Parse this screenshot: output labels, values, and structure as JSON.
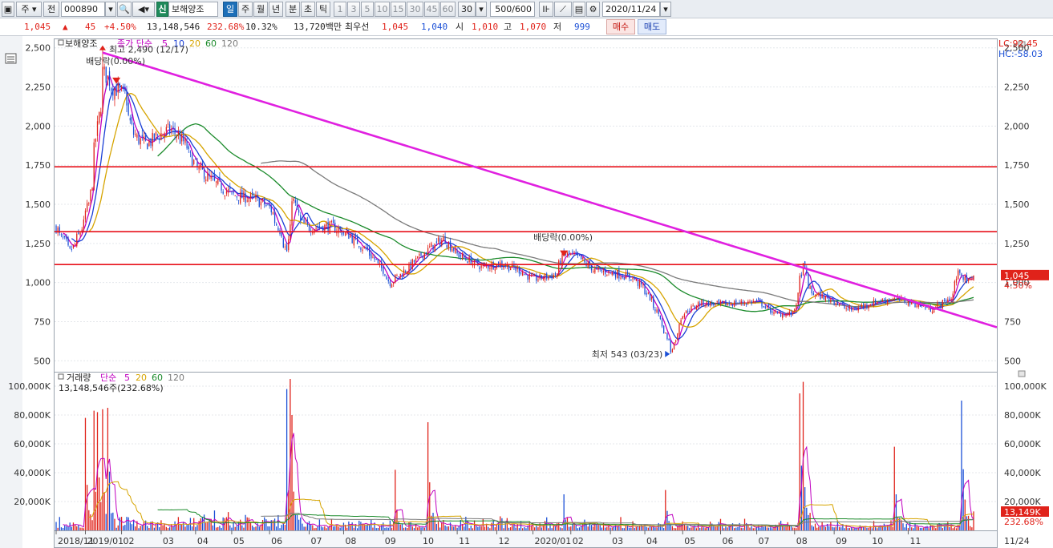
{
  "toolbar": {
    "type_label": "주",
    "type2_label": "전",
    "code_value": "000890",
    "badge_label": "신",
    "stock_name": "보해양조",
    "periods": [
      "일",
      "주",
      "월",
      "년",
      "분",
      "초",
      "틱"
    ],
    "active_period": "일",
    "minute_options": [
      "1",
      "3",
      "5",
      "10",
      "15",
      "30",
      "45",
      "60"
    ],
    "count_value": "30",
    "range_value": "500/600",
    "date_value": "2020/11/24"
  },
  "quote": {
    "price": "1,045",
    "change_arrow": "▲",
    "change": "45",
    "change_pct": "+4.50%",
    "volume": "13,148,546",
    "volume_pct": "232.68%",
    "turnover": "10.32%",
    "amount": "13,720백만",
    "priority_label": "최우선",
    "ask": "1,045",
    "bid": "1,040",
    "open_label": "시",
    "open": "1,010",
    "high_label": "고",
    "high": "1,070",
    "low_label": "저",
    "low": "999",
    "buy_label": "매수",
    "sell_label": "매도"
  },
  "price_panel": {
    "legend_name": "보해양조",
    "legend_ma_title": "종가 단순",
    "ma_periods": [
      "5",
      "10",
      "20",
      "60",
      "120"
    ],
    "ma_colors": [
      "#c000c0",
      "#1a3fd6",
      "#d6a400",
      "#1a8a2a",
      "#7a7a7a"
    ],
    "ylim": [
      430,
      2560
    ],
    "y_ticks": [
      500,
      750,
      1000,
      1250,
      1500,
      1750,
      2000,
      2250,
      2500
    ],
    "y_tick_labels": [
      "500",
      "750",
      "1,000",
      "1,250",
      "1,500",
      "1,750",
      "2,000",
      "2,250",
      "2,500"
    ],
    "lc_label": "LC:92.45",
    "hc_label": "HC:-58.03",
    "last_price_label": "1,045",
    "last_change_label": "4.50%",
    "last_price_value": 1045,
    "high_annotation": "최고 2,490 (12/17)",
    "high_value": 2490,
    "low_annotation": "최저 543 (03/23)",
    "low_value": 543,
    "dividend_label_1": "배당락(0.00%)",
    "dividend_label_2": "배당락(0.00%)",
    "horizontal_lines": [
      1740,
      1325,
      1115
    ],
    "horizontal_line_color": "#e8101a",
    "trendline_color": "#e020e0",
    "trendline": {
      "start_date": "2018-12-17",
      "start_value": 2470,
      "end_date": "2020-11-24",
      "end_value": 760
    },
    "up_color": "#e0221a",
    "down_color": "#1a4fd6"
  },
  "volume_panel": {
    "legend_name": "거래량",
    "legend_ma_title": "단순",
    "ma_periods": [
      "5",
      "20",
      "60",
      "120"
    ],
    "ma_colors": [
      "#c000c0",
      "#d6a400",
      "#1a8a2a",
      "#7a7a7a"
    ],
    "info_label": "13,148,546주(232.68%)",
    "ylim": [
      0,
      110000
    ],
    "y_ticks": [
      20000,
      40000,
      60000,
      80000,
      100000
    ],
    "y_tick_labels": [
      "20,000K",
      "40,000K",
      "60,000K",
      "80,000K",
      "100,000K"
    ],
    "last_volume_label": "13,149K",
    "last_pct_label": "232.68%"
  },
  "x_axis": {
    "labels": [
      "2018/11",
      "2019/01",
      "02",
      "03",
      "04",
      "05",
      "06",
      "07",
      "08",
      "09",
      "10",
      "11",
      "12",
      "2020/01",
      "02",
      "03",
      "04",
      "05",
      "06",
      "07",
      "08",
      "09",
      "10",
      "11"
    ],
    "end_label": "11/24"
  },
  "chart_data": {
    "type": "candlestick",
    "title": "보해양조",
    "x_start": "2018-11-08",
    "x_end": "2020-11-24",
    "price_anchors": [
      [
        "2018-11-08",
        1350
      ],
      [
        "2018-11-20",
        1200
      ],
      [
        "2018-11-27",
        1300
      ],
      [
        "2018-12-05",
        1500
      ],
      [
        "2018-12-10",
        1850
      ],
      [
        "2018-12-17",
        2350
      ],
      [
        "2018-12-24",
        2250
      ],
      [
        "2019-01-03",
        2200
      ],
      [
        "2019-01-10",
        1950
      ],
      [
        "2019-01-20",
        1880
      ],
      [
        "2019-02-01",
        1950
      ],
      [
        "2019-02-10",
        1980
      ],
      [
        "2019-02-20",
        1900
      ],
      [
        "2019-03-01",
        1750
      ],
      [
        "2019-03-15",
        1650
      ],
      [
        "2019-04-01",
        1560
      ],
      [
        "2019-04-20",
        1530
      ],
      [
        "2019-05-01",
        1480
      ],
      [
        "2019-05-10",
        1320
      ],
      [
        "2019-05-15",
        1200
      ],
      [
        "2019-05-20",
        1550
      ],
      [
        "2019-05-25",
        1400
      ],
      [
        "2019-06-01",
        1350
      ],
      [
        "2019-06-20",
        1360
      ],
      [
        "2019-07-05",
        1300
      ],
      [
        "2019-07-20",
        1200
      ],
      [
        "2019-08-01",
        1080
      ],
      [
        "2019-08-07",
        1000
      ],
      [
        "2019-08-20",
        1080
      ],
      [
        "2019-09-05",
        1200
      ],
      [
        "2019-09-20",
        1280
      ],
      [
        "2019-10-01",
        1180
      ],
      [
        "2019-10-20",
        1100
      ],
      [
        "2019-11-05",
        1120
      ],
      [
        "2019-11-20",
        1080
      ],
      [
        "2019-12-01",
        1020
      ],
      [
        "2019-12-20",
        1050
      ],
      [
        "2019-12-26",
        1180
      ],
      [
        "2020-01-05",
        1170
      ],
      [
        "2020-01-20",
        1080
      ],
      [
        "2020-02-05",
        1060
      ],
      [
        "2020-02-20",
        1030
      ],
      [
        "2020-03-01",
        960
      ],
      [
        "2020-03-12",
        800
      ],
      [
        "2020-03-23",
        560
      ],
      [
        "2020-04-01",
        800
      ],
      [
        "2020-04-15",
        870
      ],
      [
        "2020-05-01",
        860
      ],
      [
        "2020-06-01",
        880
      ],
      [
        "2020-06-15",
        800
      ],
      [
        "2020-06-30",
        800
      ],
      [
        "2020-07-08",
        1100
      ],
      [
        "2020-07-15",
        930
      ],
      [
        "2020-08-01",
        890
      ],
      [
        "2020-08-15",
        820
      ],
      [
        "2020-09-01",
        870
      ],
      [
        "2020-09-20",
        900
      ],
      [
        "2020-10-05",
        870
      ],
      [
        "2020-10-20",
        830
      ],
      [
        "2020-11-05",
        900
      ],
      [
        "2020-11-12",
        1080
      ],
      [
        "2020-11-18",
        1000
      ],
      [
        "2020-11-24",
        1045
      ]
    ],
    "volume_spikes": [
      [
        "2018-12-03",
        78000
      ],
      [
        "2018-12-10",
        83000
      ],
      [
        "2018-12-12",
        82000
      ],
      [
        "2018-12-17",
        84000
      ],
      [
        "2018-12-20",
        85000
      ],
      [
        "2019-05-15",
        98000
      ],
      [
        "2019-05-17",
        105000
      ],
      [
        "2019-05-20",
        80000
      ],
      [
        "2019-08-10",
        42000
      ],
      [
        "2019-09-06",
        75000
      ],
      [
        "2019-12-26",
        25000
      ],
      [
        "2020-03-18",
        28000
      ],
      [
        "2020-07-06",
        95000
      ],
      [
        "2020-07-08",
        103000
      ],
      [
        "2020-09-20",
        58000
      ],
      [
        "2020-11-13",
        90000
      ]
    ]
  }
}
